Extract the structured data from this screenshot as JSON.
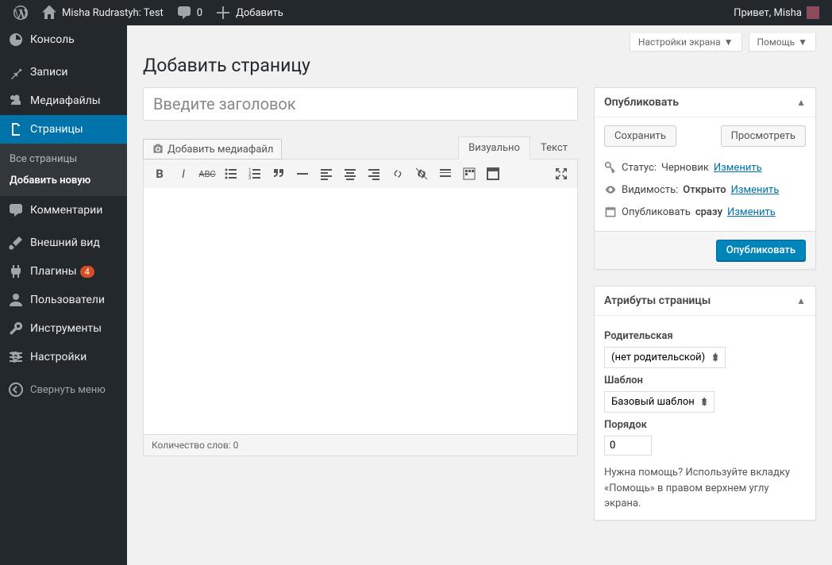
{
  "adminbar": {
    "site_title": "Misha Rudrastyh: Test",
    "comments_count": "0",
    "add_new": "Добавить",
    "greeting": "Привет, Misha"
  },
  "sidebar": {
    "dashboard": "Консоль",
    "posts": "Записи",
    "media": "Медиафайлы",
    "pages": "Страницы",
    "pages_sub_all": "Все страницы",
    "pages_sub_add": "Добавить новую",
    "comments": "Комментарии",
    "appearance": "Внешний вид",
    "plugins": "Плагины",
    "plugins_badge": "4",
    "users": "Пользователи",
    "tools": "Инструменты",
    "settings": "Настройки",
    "collapse": "Свернуть меню"
  },
  "top_tabs": {
    "screen_options": "Настройки экрана",
    "help": "Помощь"
  },
  "page": {
    "heading": "Добавить страницу",
    "title_placeholder": "Введите заголовок",
    "add_media": "Добавить медиафайл",
    "tab_visual": "Визуально",
    "tab_text": "Текст",
    "word_count": "Количество слов: 0"
  },
  "publish": {
    "box_title": "Опубликовать",
    "save_draft": "Сохранить",
    "preview": "Просмотреть",
    "status_label": "Статус:",
    "status_value": "Черновик",
    "visibility_label": "Видимость:",
    "visibility_value": "Открыто",
    "schedule_label": "Опубликовать",
    "schedule_value": "сразу",
    "edit": "Изменить",
    "publish_btn": "Опубликовать"
  },
  "attributes": {
    "box_title": "Атрибуты страницы",
    "parent_label": "Родительская",
    "parent_value": "(нет родительской)",
    "template_label": "Шаблон",
    "template_value": "Базовый шаблон",
    "order_label": "Порядок",
    "order_value": "0",
    "help": "Нужна помощь? Используйте вкладку «Помощь» в правом верхнем углу экрана."
  }
}
